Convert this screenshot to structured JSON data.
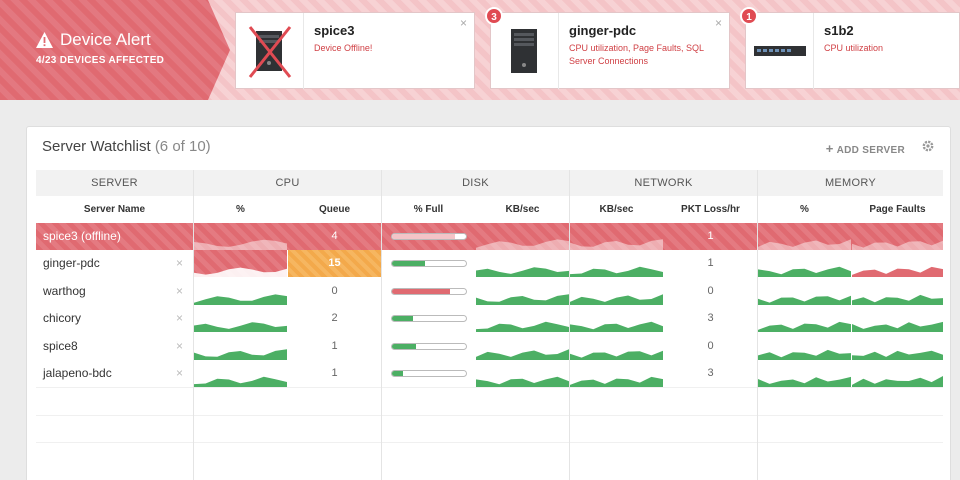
{
  "alert": {
    "title": "Device Alert",
    "subtitle": "4/23 DEVICES AFFECTED"
  },
  "alerts": [
    {
      "name": "spice3",
      "message": "Device Offline!",
      "badge": "",
      "icon": "server-tower-offline-icon"
    },
    {
      "name": "ginger-pdc",
      "message": "CPU utilization, Page Faults, SQL Server Connections",
      "badge": "3",
      "icon": "server-tower-icon"
    },
    {
      "name": "s1b2",
      "message": "CPU utilization",
      "badge": "1",
      "icon": "network-switch-icon"
    }
  ],
  "close_glyph": "×",
  "watchlist": {
    "title": "Server Watchlist",
    "count": "(6 of 10)",
    "add_server": "ADD SERVER",
    "groups": [
      "SERVER",
      "CPU",
      "DISK",
      "NETWORK",
      "MEMORY"
    ],
    "columns": [
      "Server Name",
      "%",
      "Queue",
      "% Full",
      "KB/sec",
      "KB/sec",
      "PKT Loss/hr",
      "%",
      "Page Faults"
    ],
    "rows": [
      {
        "name": "spice3 (offline)",
        "queue": "4",
        "disk_full": 0.85,
        "pkt_loss": "1",
        "status": "offline"
      },
      {
        "name": "ginger-pdc",
        "queue": "15",
        "disk_full": 0.45,
        "pkt_loss": "1",
        "status": "alert"
      },
      {
        "name": "warthog",
        "queue": "0",
        "disk_full": 0.78,
        "pkt_loss": "0",
        "status": "ok"
      },
      {
        "name": "chicory",
        "queue": "2",
        "disk_full": 0.28,
        "pkt_loss": "3",
        "status": "ok"
      },
      {
        "name": "spice8",
        "queue": "1",
        "disk_full": 0.33,
        "pkt_loss": "0",
        "status": "ok"
      },
      {
        "name": "jalapeno-bdc",
        "queue": "1",
        "disk_full": 0.15,
        "pkt_loss": "3",
        "status": "ok"
      }
    ]
  },
  "colors": {
    "alert": "#e06a71",
    "ok": "#4caf64",
    "warn": "#f3a94b"
  }
}
